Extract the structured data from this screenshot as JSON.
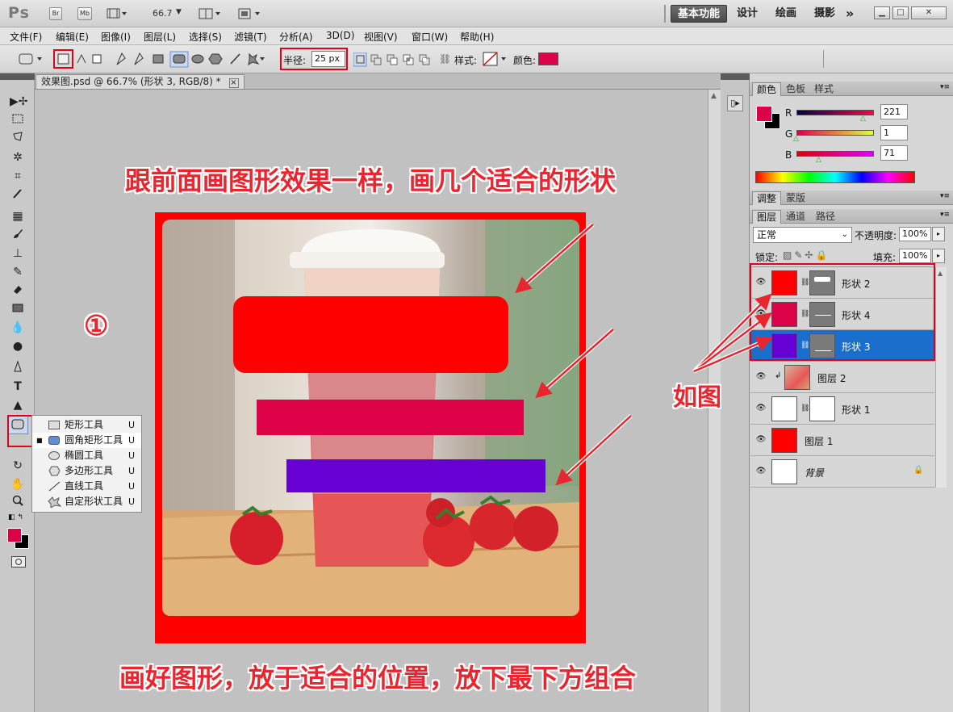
{
  "app": {
    "logo": "Ps",
    "bridge": "Br",
    "minibridge": "Mb",
    "zoom": "66.7",
    "workspaces": [
      "基本功能",
      "设计",
      "绘画",
      "摄影"
    ],
    "more": "»"
  },
  "menu": [
    "文件(F)",
    "编辑(E)",
    "图像(I)",
    "图层(L)",
    "选择(S)",
    "滤镜(T)",
    "分析(A)",
    "3D(D)",
    "视图(V)",
    "窗口(W)",
    "帮助(H)"
  ],
  "options": {
    "radius_label": "半径:",
    "radius_value": "25 px",
    "style_label": "样式:",
    "color_label": "颜色:",
    "color": "#dd0147"
  },
  "document": {
    "tab_title": "效果图.psd @ 66.7% (形状 3, RGB/8) *",
    "close": "×"
  },
  "annotations": {
    "top": "跟前面画图形效果一样，画几个适合的形状",
    "bottom": "画好图形，放于适合的位置，放下最下方组合",
    "circle": "①",
    "asfig": "如图"
  },
  "shapes": {
    "shape2_color": "#ff0000",
    "shape4_color": "#dd0147",
    "shape3_color": "#6600d5"
  },
  "flyout": {
    "items": [
      {
        "label": "矩形工具",
        "key": "U",
        "active": false
      },
      {
        "label": "圆角矩形工具",
        "key": "U",
        "active": true
      },
      {
        "label": "椭圆工具",
        "key": "U",
        "active": false
      },
      {
        "label": "多边形工具",
        "key": "U",
        "active": false
      },
      {
        "label": "直线工具",
        "key": "U",
        "active": false
      },
      {
        "label": "自定形状工具",
        "key": "U",
        "active": false
      }
    ]
  },
  "color_panel": {
    "tabs": [
      "颜色",
      "色板",
      "样式"
    ],
    "r_label": "R",
    "r_value": "221",
    "g_label": "G",
    "g_value": "1",
    "b_label": "B",
    "b_value": "71"
  },
  "adjust_panel": {
    "tabs": [
      "调整",
      "蒙版"
    ]
  },
  "layers_panel": {
    "tabs": [
      "图层",
      "通道",
      "路径"
    ],
    "blend_mode": "正常",
    "opacity_label": "不透明度:",
    "opacity_value": "100%",
    "lock_label": "锁定:",
    "fill_label": "填充:",
    "fill_value": "100%",
    "layers": [
      {
        "name": "形状 2",
        "selected": false
      },
      {
        "name": "形状 4",
        "selected": false
      },
      {
        "name": "形状 3",
        "selected": true
      },
      {
        "name": "图层 2",
        "selected": false
      },
      {
        "name": "形状 1",
        "selected": false
      },
      {
        "name": "图层 1",
        "selected": false
      },
      {
        "name": "背景",
        "selected": false
      }
    ]
  }
}
